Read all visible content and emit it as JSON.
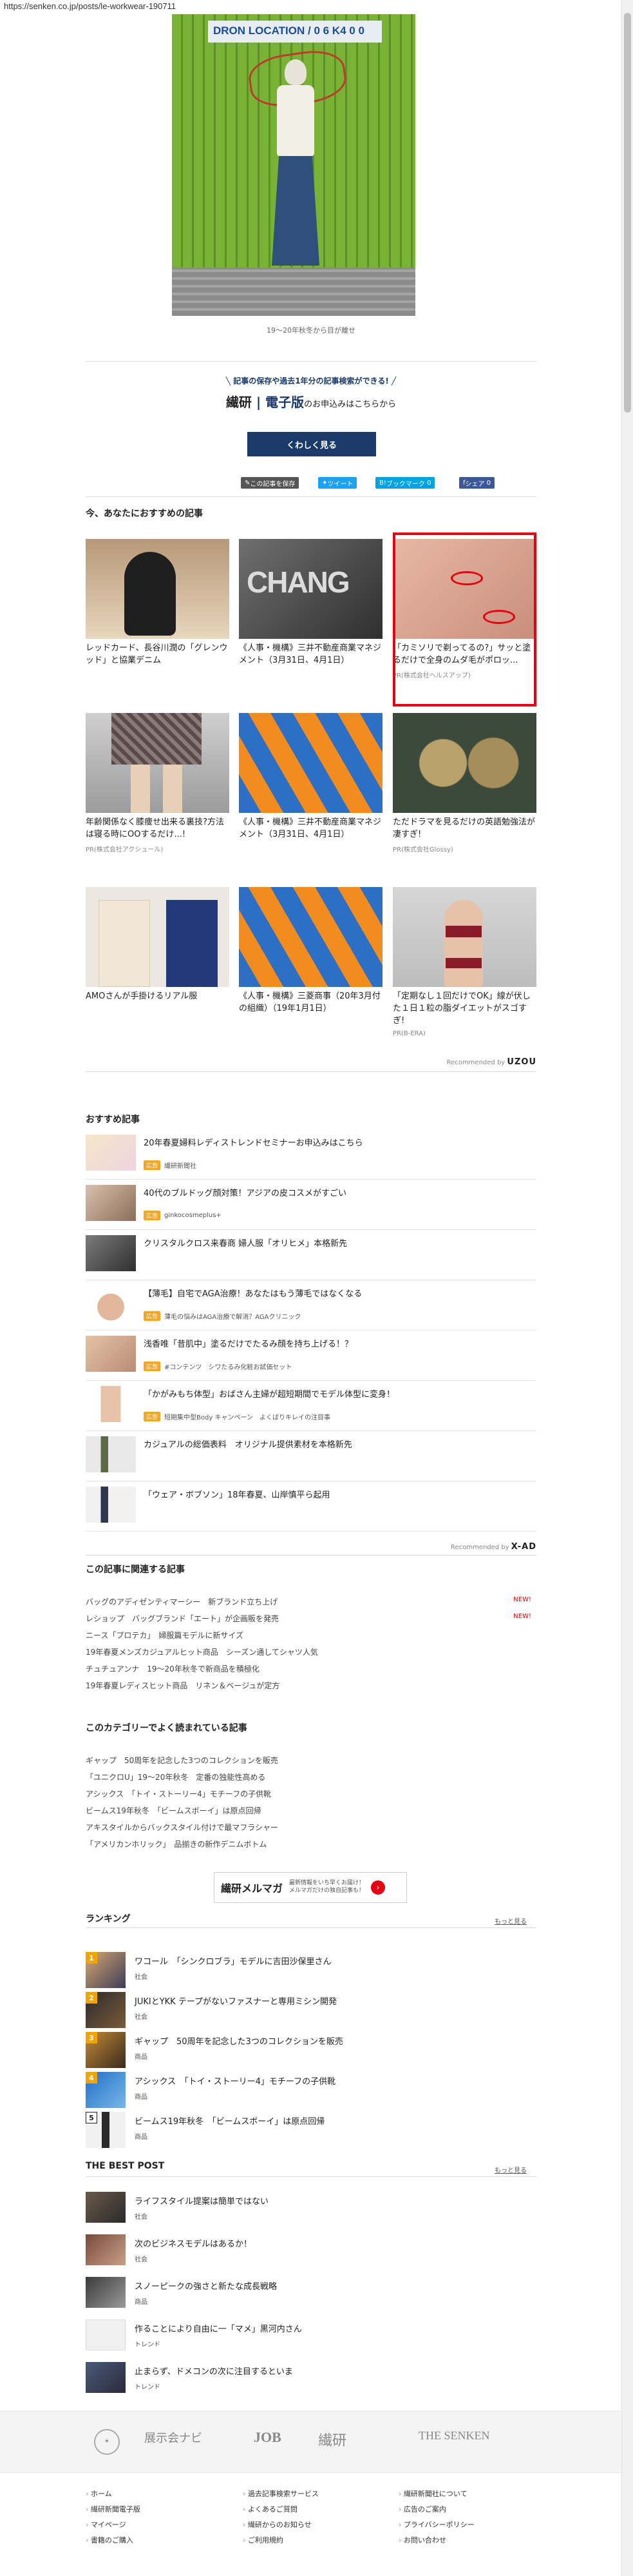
{
  "browser": {
    "url": "https://senken.co.jp/posts/le-workwear-190711"
  },
  "hero": {
    "sign_text": "DRON LOCATION / 0 6 K4 0 0"
  },
  "caption": "19〜20年秋冬から目が離せ",
  "promo": {
    "lead": "記事の保存や過去1年分の記事検索ができる!",
    "brand_a": "繊研",
    "brand_b": "電子版",
    "tail": "のお申込みはこちらから",
    "button": "くわしく見る"
  },
  "share": {
    "save": "この記事を保存",
    "tweet": "ツイート",
    "bookmark": "ブックマーク",
    "bookmark_count": "0",
    "fb": "シェア",
    "fb_count": "0"
  },
  "recommend": {
    "title": "今、あなたにおすすめの記事",
    "cards": [
      {
        "title": "レッドカード、長谷川潤の「グレンウッド」と協業デニム",
        "pr": ""
      },
      {
        "title": "《人事・機構》三井不動産商業マネジメント（3月31日、4月1日）",
        "pr": ""
      },
      {
        "title": "「カミソリで剃ってるの?」サッと塗るだけで全身のムダ毛がポロッ...",
        "pr": "PR(株式会社ヘルスアップ)"
      },
      {
        "title": "年齢関係なく膝痩せ出来る裏技?方法は寝る時にOOするだけ...!",
        "pr": "PR(株式会社アクシュール)"
      },
      {
        "title": "《人事・機構》三井不動産商業マネジメント（3月31日、4月1日）",
        "pr": ""
      },
      {
        "title": "ただドラマを見るだけの英語勉強法が凄すぎ!",
        "pr": "PR(株式会社Glossy)"
      },
      {
        "title": "AMOさんが手掛けるリアル服",
        "pr": ""
      },
      {
        "title": "《人事・機構》三菱商事（20年3月付の組織）（19年1月1日）",
        "pr": ""
      },
      {
        "title": "「定期なし１回だけでOK」線が伏した１日１粒の脂ダイエットがスゴすぎ!",
        "pr": "PR(B-ERA)"
      }
    ],
    "by_label": "Recommended by",
    "by_brand": "UZOU"
  },
  "osusume": {
    "title": "おすすめ記事",
    "items": [
      {
        "title": "20年春夏婦料レディストレンドセミナーお申込みはこちら",
        "badge": "広告",
        "sponsor": "繊研新聞社"
      },
      {
        "title": "40代のブルドッグ顔対策！アジアの皮コスメがすごい",
        "badge": "広告",
        "sponsor": "ginkocosmeplus+"
      },
      {
        "title": "クリスタルクロス来春商 婦人服「オリヒメ」本格新先",
        "badge": "",
        "sponsor": ""
      },
      {
        "title": "【薄毛】自宅でAGA治療！あなたはもう薄毛ではなくなる",
        "badge": "広告",
        "sponsor": "薄毛の悩みはAGA治療で解消？AGAクリニック"
      },
      {
        "title": "浅香唯「昔肌中」塗るだけでたるみ顔を持ち上げる！？",
        "badge": "広告",
        "sponsor": "#コンテンツ　シワたるみ化粧お試価セット"
      },
      {
        "title": "「かがみもち体型」おばさん主婦が超短期間でモデル体型に変身！",
        "badge": "広告",
        "sponsor": "短期集中型Body キャンペーン　よくばりキレイの注目事"
      },
      {
        "title": "カジュアルの総価表料　オリジナル提供素材を本格新先",
        "badge": "",
        "sponsor": ""
      },
      {
        "title": "「ウェア・ボブソン」18年春夏、山岸慎平ら起用",
        "badge": "",
        "sponsor": ""
      }
    ],
    "by_label": "Recommended by",
    "by_brand": "X-AD"
  },
  "related": {
    "title": "この記事に関連する記事",
    "items": [
      {
        "title": "バッグのアディゼンティマーシー　新ブランド立ち上げ",
        "new": "NEW!"
      },
      {
        "title": "レショップ　バッグブランド「エート」が企画販を発売",
        "new": "NEW!"
      },
      {
        "title": "ニース「プロテカ」　婦服篇モデルに新サイズ",
        "new": ""
      },
      {
        "title": "19年春夏メンズカジュアルヒット商品　シーズン通してシャツ人気",
        "new": ""
      },
      {
        "title": "チュチュアンナ　19〜20年秋冬で新商品を積極化",
        "new": ""
      },
      {
        "title": "19年春夏レディスヒット商品　リネン＆ベージュが定方",
        "new": ""
      }
    ]
  },
  "category": {
    "title": "このカテゴリーでよく読まれている記事",
    "items": [
      "ギャップ　50周年を記念した3つのコレクションを販売",
      "「ユニクロU」19〜20年秋冬　定番の独能性高める",
      "アシックス　「トイ・ストーリー4」モチーフの子供靴",
      "ビームス19年秋冬　「ビームスボーイ」は原点回帰",
      "アキスタイルからバックスタイル付けで最マフラシャー",
      "「アメリカンホリック」　品揃きの新作デニムボトム"
    ]
  },
  "magazine": {
    "name": "繊研メルマガ",
    "desc1": "最新情報をいち早くお届け！",
    "desc2": "メルマガだけの独自記事も！",
    "go": "›"
  },
  "ranking": {
    "title": "ランキング",
    "more": "もっと見る",
    "items": [
      {
        "n": "1",
        "title": "ワコール　「シンクロブラ」モデルに吉田沙保里さん",
        "cat": "社会"
      },
      {
        "n": "2",
        "title": "JUKIとYKK テープがないファスナーと専用ミシン開発",
        "cat": "社会"
      },
      {
        "n": "3",
        "title": "ギャップ　50周年を記念した3つのコレクションを販売",
        "cat": "商品"
      },
      {
        "n": "4",
        "title": "アシックス　「トイ・ストーリー4」モチーフの子供靴",
        "cat": "商品"
      },
      {
        "n": "5",
        "title": "ビームス19年秋冬　「ビームスボーイ」は原点回帰",
        "cat": "商品"
      }
    ]
  },
  "bestpost": {
    "title": "THE BEST POST",
    "more": "もっと見る",
    "items": [
      {
        "title": "ライフスタイル提案は簡単ではない",
        "cat": "社会"
      },
      {
        "title": "次のビジネスモデルはあるか！",
        "cat": "社会"
      },
      {
        "title": "スノーピークの強さと新たな成長戦略",
        "cat": "商品"
      },
      {
        "title": "作ることにより自由に一「マメ」黒河内さん",
        "cat": "トレンド"
      },
      {
        "title": "止まらず、ドメコンの次に注目するといま",
        "cat": "トレンド"
      }
    ]
  },
  "footer": {
    "logos": {
      "tenji": "展示会ナビ",
      "job": "JOB",
      "senken": "繊研",
      "thesenken": "THE SENKEN"
    },
    "col1": [
      "ホーム",
      "繊研新聞電子版",
      "マイページ",
      "書籍のご購入"
    ],
    "col2": [
      "過去記事検索サービス",
      "よくあるご質問",
      "繊研からのお知らせ",
      "ご利用規約"
    ],
    "col3": [
      "繊研新聞社について",
      "広告のご案内",
      "プライバシーポリシー",
      "お問い合わせ"
    ]
  },
  "colors": {
    "navy": "#1a3a6b",
    "highlight": "#e60012",
    "accent": "#f2a500"
  }
}
